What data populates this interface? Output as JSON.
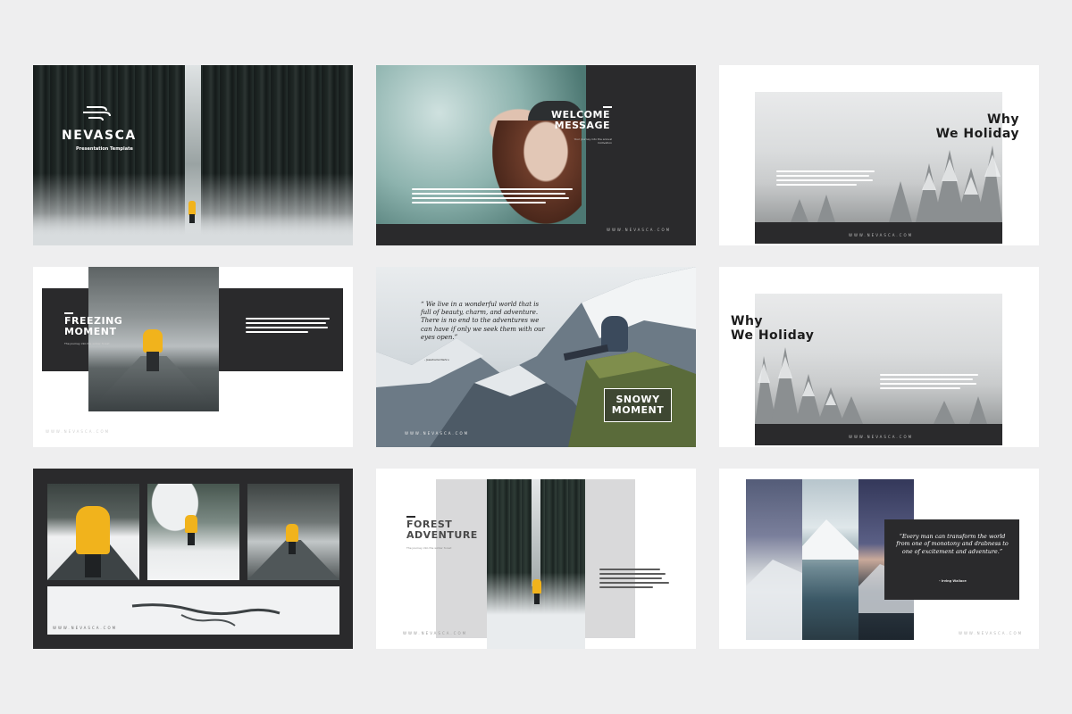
{
  "slides": {
    "s1": {
      "brand": "NEVASCA",
      "subtitle": "Presentation Template"
    },
    "s2": {
      "title_line1": "WELCOME",
      "title_line2": "MESSAGE",
      "caption": "Your journey into the annual motivation",
      "footer": "WWW.NEVASCA.COM"
    },
    "s3": {
      "title_line1": "Why",
      "title_line2": "We Holiday",
      "footer": "WWW.NEVASCA.COM"
    },
    "s4": {
      "title_line1": "FREEZING",
      "title_line2": "MOMENT",
      "caption": "The journey into the winter forest",
      "footer": "WWW.NEVASCA.COM"
    },
    "s5": {
      "quote": "“ We live in a wonderful world that is full of beauty, charm, and adventure. There is no end to the adventures we can have if only we seek them with our eyes open.”",
      "author": "- Jawaharlal Nehru",
      "badge_line1": "SNOWY",
      "badge_line2": "MOMENT",
      "footer": "WWW.NEVASCA.COM"
    },
    "s6": {
      "title_line1": "Why",
      "title_line2": "We Holiday",
      "footer": "WWW.NEVASCA.COM"
    },
    "s7": {
      "footer": "WWW.NEVASCA.COM"
    },
    "s8": {
      "title_line1": "FOREST",
      "title_line2": "ADVENTURE",
      "caption": "The journey into the winter forest",
      "footer": "WWW.NEVASCA.COM"
    },
    "s9": {
      "quote": "“Every man can transform the world from one of monotony and drabness to one of excitement and adventure.”",
      "author": "- Irving Wallace",
      "footer": "WWW.NEVASCA.COM"
    }
  },
  "colors": {
    "canvas": "#eeeeef",
    "dark": "#2a2a2c",
    "accent_yellow": "#f1b31c",
    "snow": "#eef0f1",
    "pine": "#1f2a26"
  }
}
